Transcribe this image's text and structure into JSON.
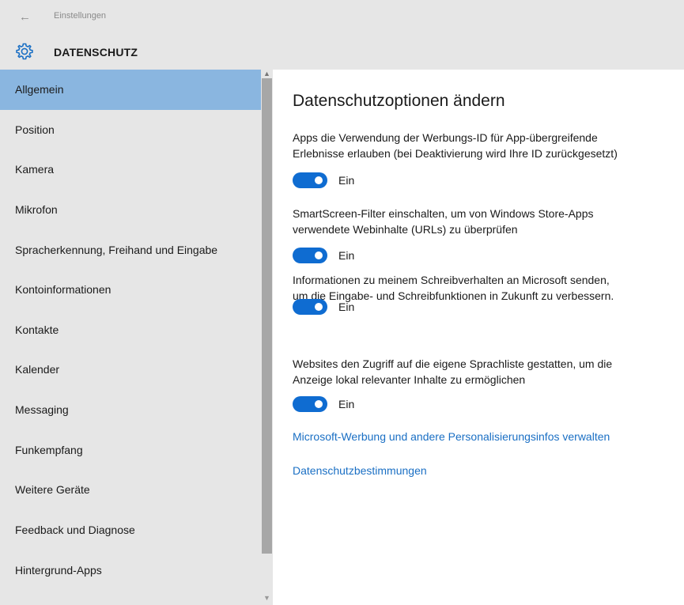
{
  "window": {
    "title": "Einstellungen"
  },
  "header": {
    "section_title": "DATENSCHUTZ",
    "icon": "gear-icon"
  },
  "sidebar": {
    "items": [
      {
        "label": "Allgemein",
        "selected": true
      },
      {
        "label": "Position",
        "selected": false
      },
      {
        "label": "Kamera",
        "selected": false
      },
      {
        "label": "Mikrofon",
        "selected": false
      },
      {
        "label": "Spracherkennung, Freihand und Eingabe",
        "selected": false
      },
      {
        "label": "Kontoinformationen",
        "selected": false
      },
      {
        "label": "Kontakte",
        "selected": false
      },
      {
        "label": "Kalender",
        "selected": false
      },
      {
        "label": "Messaging",
        "selected": false
      },
      {
        "label": "Funkempfang",
        "selected": false
      },
      {
        "label": "Weitere Geräte",
        "selected": false
      },
      {
        "label": "Feedback und Diagnose",
        "selected": false
      },
      {
        "label": "Hintergrund-Apps",
        "selected": false
      }
    ]
  },
  "main": {
    "title": "Datenschutzoptionen ändern",
    "options": [
      {
        "text_line1": "Apps die Verwendung der Werbungs-ID für App-übergreifende",
        "text_line2": "Erlebnisse erlauben (bei Deaktivierung wird Ihre ID zurückgesetzt)",
        "toggle_label": "Ein",
        "on": true
      },
      {
        "text_line1": "SmartScreen-Filter einschalten, um von Windows Store-Apps",
        "text_line2": "verwendete Webinhalte (URLs) zu überprüfen",
        "toggle_label": "Ein",
        "on": true
      },
      {
        "text_line1": "Informationen zu meinem Schreibverhalten an Microsoft senden,",
        "text_line2": "um die Eingabe- und Schreibfunktionen in Zukunft zu verbessern.",
        "toggle_label": "Ein",
        "on": true
      },
      {
        "text_line1": "Websites den Zugriff auf die eigene Sprachliste gestatten, um die",
        "text_line2": "Anzeige lokal relevanter Inhalte zu ermöglichen",
        "toggle_label": "Ein",
        "on": true
      }
    ],
    "links": {
      "advertising": "Microsoft-Werbung und andere Personalisierungsinfos verwalten",
      "privacy_statement": "Datenschutzbestimmungen"
    }
  },
  "colors": {
    "accent": "#0f6cd1",
    "link": "#1a6fc4",
    "selected_item": "#8ab6e0",
    "chrome": "#e6e6e6"
  }
}
